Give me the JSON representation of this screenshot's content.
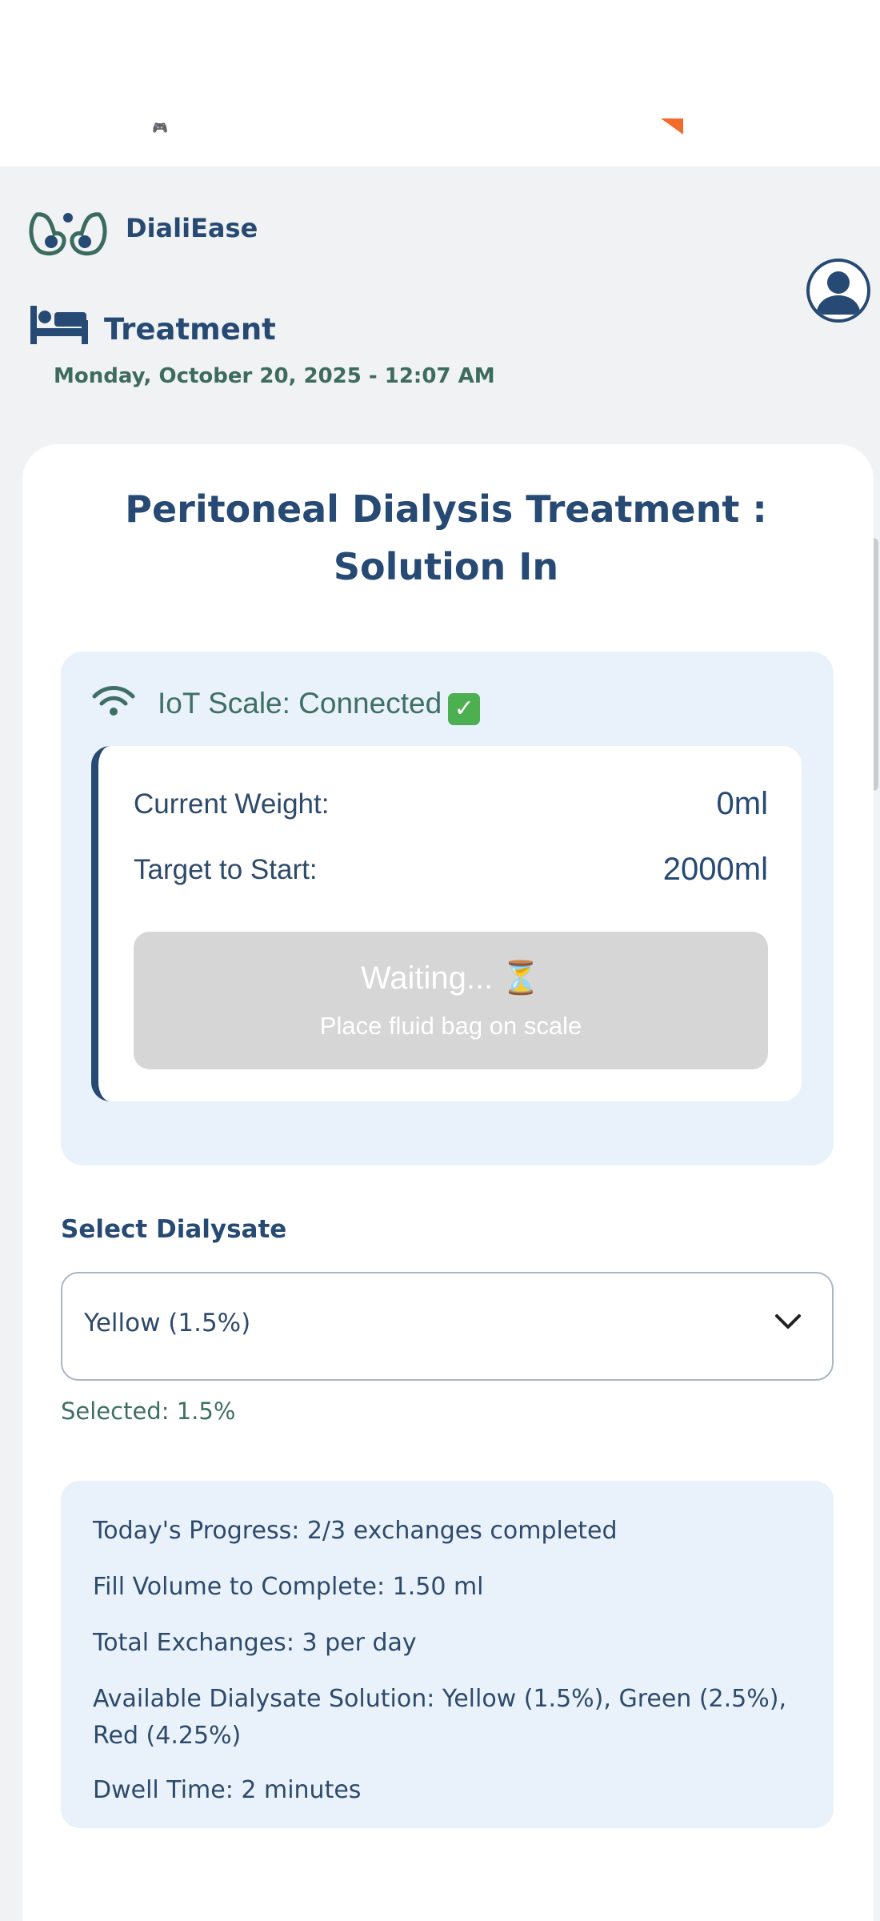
{
  "status_bar": {
    "glyph": "🎮"
  },
  "header": {
    "app_name": "DialiEase",
    "page_title": "Treatment",
    "date_time": "Monday, October 20, 2025 - 12:07 AM"
  },
  "card": {
    "title_line1": "Peritoneal Dialysis Treatment :",
    "title_line2": "Solution In"
  },
  "iot": {
    "status": "IoT Scale: Connected",
    "check_glyph": "✓",
    "current_weight_label": "Current Weight:",
    "current_weight_value": "0ml",
    "target_label": "Target to Start:",
    "target_value": "2000ml",
    "waiting_title": "Waiting...",
    "waiting_glyph": "⏳",
    "waiting_subtitle": "Place fluid bag on scale"
  },
  "dialysate": {
    "label": "Select Dialysate",
    "selected_option": "Yellow (1.5%)",
    "selected_text": "Selected: 1.5%"
  },
  "progress_info": {
    "lines": [
      "Today's Progress: 2/3 exchanges completed",
      "Fill Volume to Complete: 1.50 ml",
      "Total Exchanges: 3 per day",
      "Available Dialysate Solution: Yellow (1.5%), Green (2.5%), Red (4.25%)",
      "Dwell Time: 2 minutes"
    ]
  },
  "colors": {
    "primary": "#264a73",
    "accent_green": "#3f6f64",
    "panel_bg": "#e9f1fb",
    "check_green": "#4caf50",
    "status_orange": "#f26b2c"
  }
}
